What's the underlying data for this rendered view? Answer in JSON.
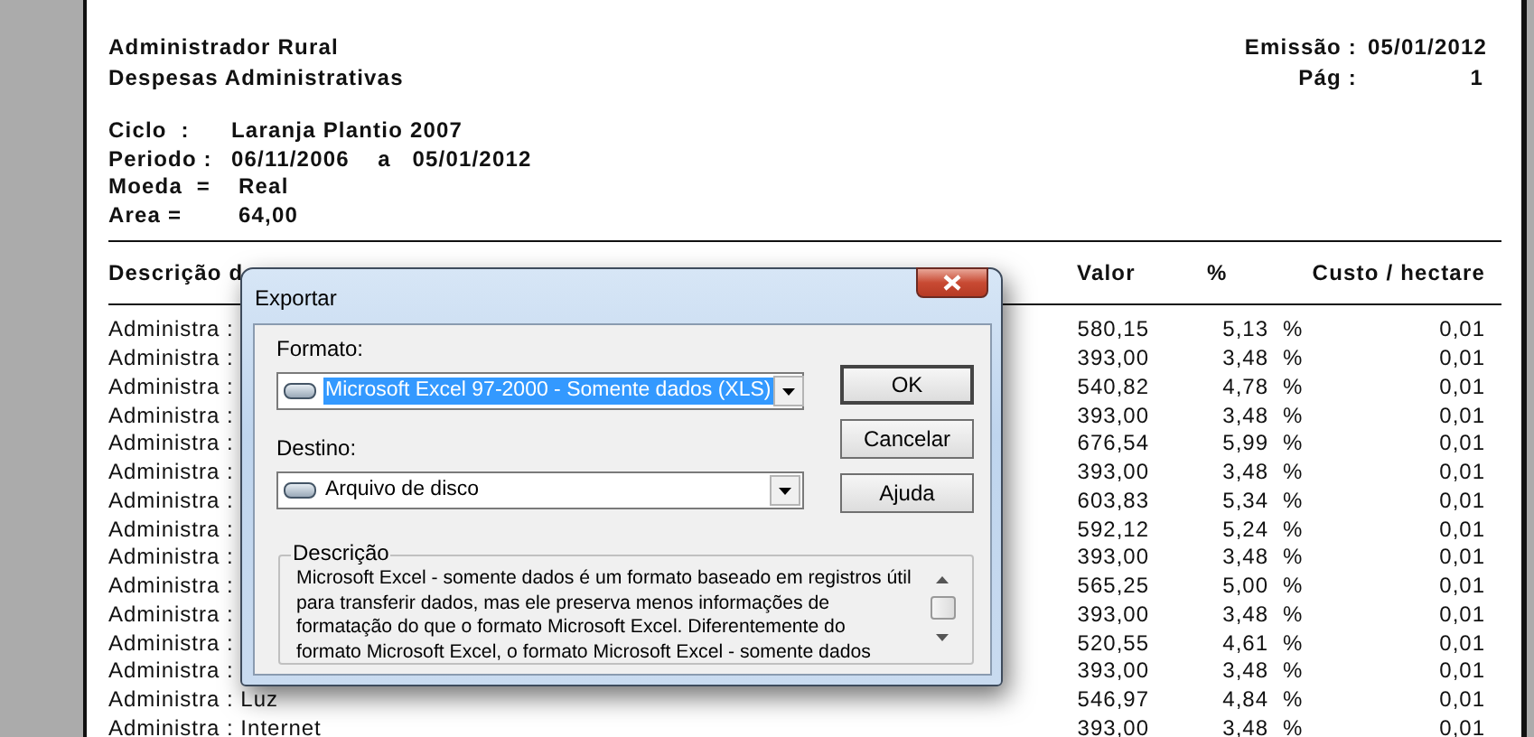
{
  "report": {
    "company": "Administrador Rural",
    "title": "Despesas Administrativas",
    "meta": [
      {
        "label": "Emissão :",
        "value": "05/01/2012"
      },
      {
        "label": "Pág :",
        "value": "1"
      }
    ],
    "fields": [
      {
        "label": "Ciclo  :",
        "value": "Laranja Plantio 2007"
      },
      {
        "label": "Periodo :",
        "value": "06/11/2006    a   05/01/2012"
      },
      {
        "label": "Moeda  =",
        "value": "Real"
      },
      {
        "label": "Area =",
        "value": "64,00"
      }
    ],
    "columns": [
      "Descrição d",
      "Valor",
      "%",
      "Custo / hectare"
    ],
    "rows": [
      {
        "description": "Administra :",
        "value": "580,15",
        "percent": "5,13",
        "unit": "%",
        "cost": "0,01"
      },
      {
        "description": "Administra :",
        "value": "393,00",
        "percent": "3,48",
        "unit": "%",
        "cost": "0,01"
      },
      {
        "description": "Administra :",
        "value": "540,82",
        "percent": "4,78",
        "unit": "%",
        "cost": "0,01"
      },
      {
        "description": "Administra :",
        "value": "393,00",
        "percent": "3,48",
        "unit": "%",
        "cost": "0,01"
      },
      {
        "description": "Administra :",
        "value": "676,54",
        "percent": "5,99",
        "unit": "%",
        "cost": "0,01"
      },
      {
        "description": "Administra :",
        "value": "393,00",
        "percent": "3,48",
        "unit": "%",
        "cost": "0,01"
      },
      {
        "description": "Administra :",
        "value": "603,83",
        "percent": "5,34",
        "unit": "%",
        "cost": "0,01"
      },
      {
        "description": "Administra :",
        "value": "592,12",
        "percent": "5,24",
        "unit": "%",
        "cost": "0,01"
      },
      {
        "description": "Administra :",
        "value": "393,00",
        "percent": "3,48",
        "unit": "%",
        "cost": "0,01"
      },
      {
        "description": "Administra :",
        "value": "565,25",
        "percent": "5,00",
        "unit": "%",
        "cost": "0,01"
      },
      {
        "description": "Administra :",
        "value": "393,00",
        "percent": "3,48",
        "unit": "%",
        "cost": "0,01"
      },
      {
        "description": "Administra :",
        "value": "520,55",
        "percent": "4,61",
        "unit": "%",
        "cost": "0,01"
      },
      {
        "description": "Administra :",
        "value": "393,00",
        "percent": "3,48",
        "unit": "%",
        "cost": "0,01"
      },
      {
        "description": "Administra : Luz",
        "value": "546,97",
        "percent": "4,84",
        "unit": "%",
        "cost": "0,01"
      },
      {
        "description": "Administra : Internet",
        "value": "393,00",
        "percent": "3,48",
        "unit": "%",
        "cost": "0,01"
      }
    ]
  },
  "dialog": {
    "title": "Exportar",
    "format": {
      "label": "Formato:",
      "value": "Microsoft Excel 97-2000 - Somente dados (XLS)",
      "highlighted": true
    },
    "destination": {
      "label": "Destino:",
      "value": "Arquivo de disco",
      "highlighted": false
    },
    "buttons": [
      {
        "label": "OK",
        "default": true
      },
      {
        "label": "Cancelar",
        "default": false
      },
      {
        "label": "Ajuda",
        "default": false
      }
    ],
    "description": {
      "label": "Descrição",
      "lines": [
        "Microsoft Excel - somente dados é um formato baseado em registros útil",
        "para transferir dados, mas ele preserva menos informações de",
        "formatação do que o formato Microsoft Excel. Diferentemente do",
        "formato Microsoft Excel, o formato Microsoft Excel - somente dados"
      ]
    }
  }
}
